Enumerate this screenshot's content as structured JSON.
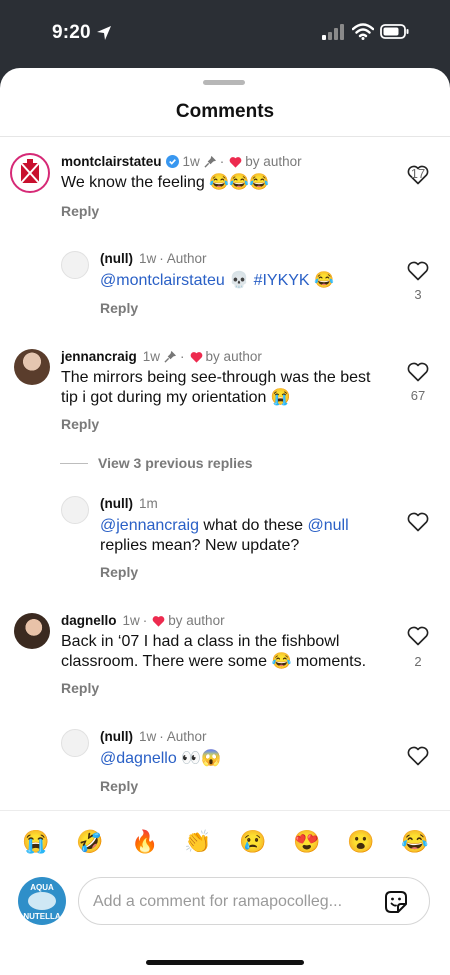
{
  "status_bar": {
    "time": "9:20"
  },
  "sheet": {
    "title": "Comments"
  },
  "comments": [
    {
      "username": "montclairstateu",
      "verified": true,
      "time": "1w",
      "pinned": true,
      "separator": "·",
      "liked_by": "by author",
      "text_before": "We know the feeling ",
      "emojis": [
        "😂",
        "😂",
        "😂"
      ],
      "reply_label": "Reply",
      "likes": "17"
    },
    {
      "username": "(null)",
      "time": "1w",
      "separator": "·",
      "author_tag": "Author",
      "mention": "@montclairstateu",
      "emoji_mid": "💀",
      "hashtag": "#IYKYK",
      "emoji_end": "😂",
      "reply_label": "Reply",
      "likes": "3"
    },
    {
      "username": "jennancraig",
      "time": "1w",
      "pinned": true,
      "separator": "·",
      "liked_by": "by author",
      "text": "The mirrors being see-through was the best tip i got during my orientation",
      "emoji_end": "😭",
      "reply_label": "Reply",
      "likes": "67"
    },
    {
      "username": "(null)",
      "time": "1m",
      "mention": "@jennancraig",
      "text_mid": " what do these ",
      "mention2": "@null",
      "text_end": "replies mean? New update?",
      "reply_label": "Reply"
    },
    {
      "username": "dagnello",
      "time": "1w",
      "separator": "·",
      "liked_by": "by author",
      "text_line1": "Back in ‘07 I had a class in the fishbowl",
      "text_line2_before": "classroom. There were some ",
      "emoji_mid": "😂",
      "text_line2_after": " moments.",
      "reply_label": "Reply",
      "likes": "2"
    },
    {
      "username": "(null)",
      "time": "1w",
      "separator": "·",
      "author_tag": "Author",
      "mention": "@dagnello",
      "emojis": [
        "👀",
        "😱"
      ],
      "reply_label": "Reply"
    }
  ],
  "view_replies": "View 3 previous replies",
  "emoji_bar": [
    "😭",
    "🤣",
    "🔥",
    "👏",
    "😢",
    "😍",
    "😮",
    "😂"
  ],
  "composer": {
    "placeholder": "Add a comment for ramapocolleg...",
    "avatar_text_top": "AQUA",
    "avatar_text_bottom": "NUTELLA"
  },
  "colors": {
    "accent_link": "#2a60c6",
    "like_heart": "#ed2b4f",
    "verified": "#3897f0"
  }
}
